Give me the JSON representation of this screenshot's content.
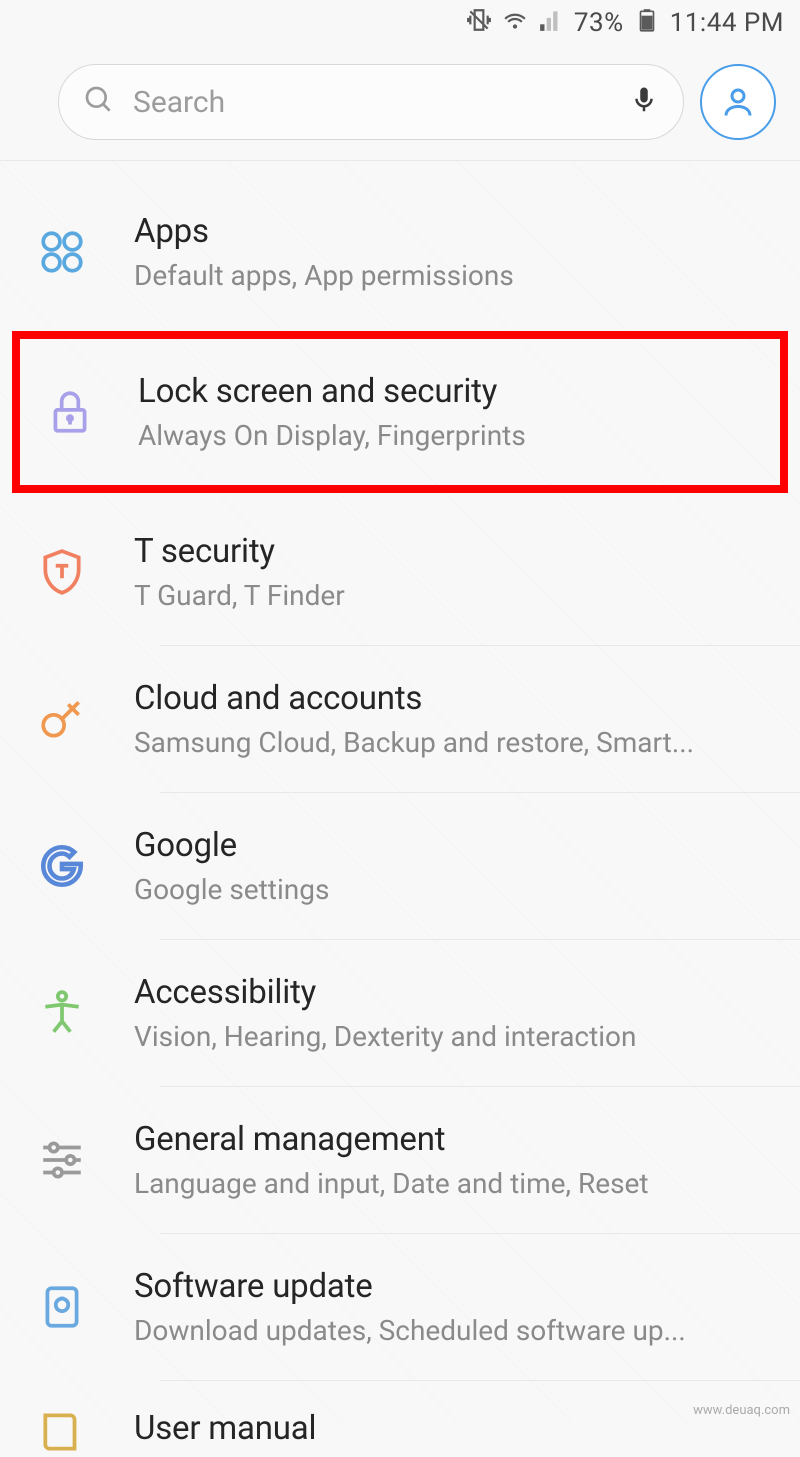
{
  "status": {
    "battery": "73%",
    "time": "11:44 PM"
  },
  "search": {
    "placeholder": "Search"
  },
  "items": [
    {
      "title": "Apps",
      "desc": "Default apps, App permissions"
    },
    {
      "title": "Lock screen and security",
      "desc": "Always On Display, Fingerprints"
    },
    {
      "title": "T security",
      "desc": "T Guard, T Finder"
    },
    {
      "title": "Cloud and accounts",
      "desc": "Samsung Cloud, Backup and restore, Smart..."
    },
    {
      "title": "Google",
      "desc": "Google settings"
    },
    {
      "title": "Accessibility",
      "desc": "Vision, Hearing, Dexterity and interaction"
    },
    {
      "title": "General management",
      "desc": "Language and input, Date and time, Reset"
    },
    {
      "title": "Software update",
      "desc": "Download updates, Scheduled software up..."
    },
    {
      "title": "User manual",
      "desc": ""
    }
  ],
  "source_url": "www.deuaq.com"
}
